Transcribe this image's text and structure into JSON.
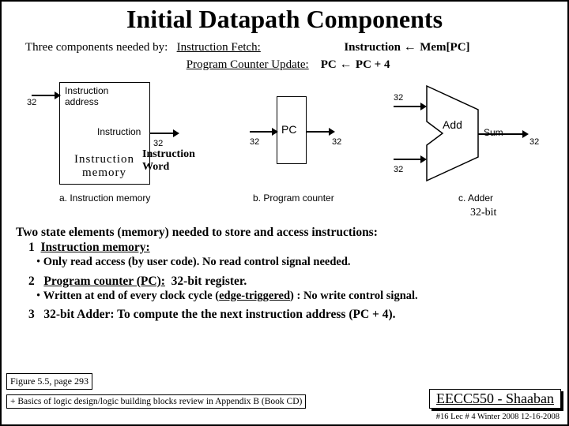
{
  "title": "Initial Datapath Components",
  "sub": {
    "prefix": "Three components needed by:",
    "row1_label": "Instruction Fetch:",
    "row1_lhs": "Instruction",
    "row1_rhs": "Mem[PC]",
    "row2_label": "Program Counter Update:",
    "row2_lhs": "PC",
    "row2_rhs": "PC + 4"
  },
  "diagram": {
    "imem": {
      "addr": "Instruction\naddress",
      "out": "Instruction",
      "name": "Instruction\nmemory",
      "caption": "a. Instruction memory",
      "width_in": "32",
      "width_out": "32",
      "iw_label": "Instruction\nWord"
    },
    "pc": {
      "label": "PC",
      "caption": "b. Program counter",
      "width": "32"
    },
    "adder": {
      "label": "Add",
      "sum": "Sum",
      "caption": "c. Adder",
      "width_a": "32",
      "width_b": "32",
      "width_out": "32",
      "note": "32-bit"
    }
  },
  "body": {
    "line1": "Two state elements (memory) needed to store and access instructions:",
    "item1_num": "1",
    "item1": "Instruction memory:",
    "item1_bullet": "Only read access  (by user code).   No read control signal needed.",
    "item2_num": "2",
    "item2_label": "Program counter (PC):",
    "item2_rest": "32-bit register.",
    "item2_bullet_a": "Written at end of every clock cycle (",
    "item2_bullet_u": "edge-triggered",
    "item2_bullet_b": ") :  No write control signal.",
    "item3_num": "3",
    "item3": "32-bit Adder: To compute the the next instruction address (PC + 4)."
  },
  "footer": {
    "fig": "Figure 5.5, page 293",
    "appendix": "+ Basics of logic design/logic building blocks review in Appendix B (Book CD)",
    "author": "EECC550 - Shaaban",
    "note": "#16   Lec # 4   Winter 2008  12-16-2008"
  }
}
